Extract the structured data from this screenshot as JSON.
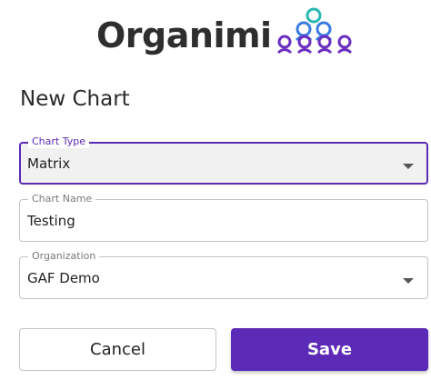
{
  "brand": {
    "name": "Organimi",
    "logo_icon": "org-chart-people-icon",
    "colors": {
      "top_node": "#2ab7b0",
      "middle_nodes": "#3a7be0",
      "bottom_nodes": "#6a2fc0"
    }
  },
  "form": {
    "title": "New Chart",
    "chart_type": {
      "label": "Chart Type",
      "value": "Matrix"
    },
    "chart_name": {
      "label": "Chart Name",
      "value": "Testing"
    },
    "organization": {
      "label": "Organization",
      "value": "GAF Demo"
    }
  },
  "actions": {
    "cancel_label": "Cancel",
    "save_label": "Save"
  },
  "colors": {
    "accent": "#5b2ab6",
    "border": "#c4c4c4"
  }
}
